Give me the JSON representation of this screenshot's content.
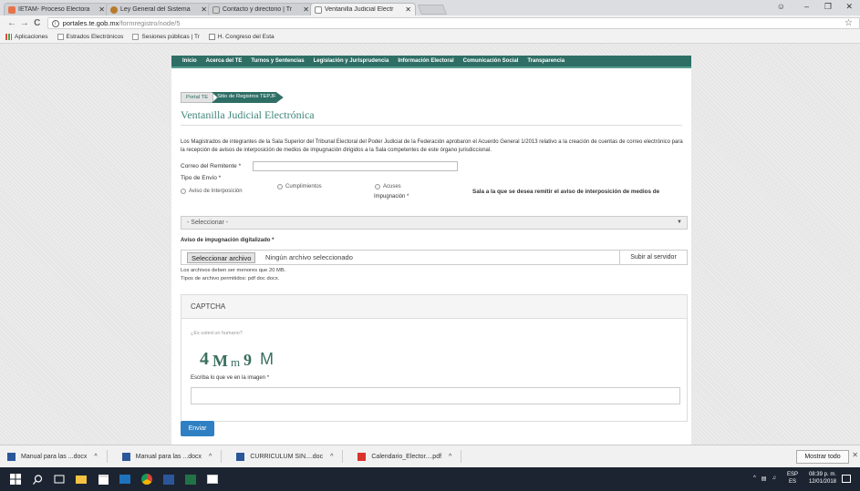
{
  "browser": {
    "tabs": [
      {
        "title": "IETAM- Proceso Electora",
        "color": "#e8734a"
      },
      {
        "title": "Ley General del Sistema",
        "color": "#b97a2a"
      },
      {
        "title": "Contacto y directorio | Tr",
        "color": "#7a7a7a"
      },
      {
        "title": "Ventanilla Judicial Electr",
        "color": "#888888"
      }
    ],
    "address": {
      "host": "portales.te.gob.mx",
      "path": "/formregistro/node/5"
    },
    "bookmarks": [
      "Aplicaciones",
      "Estrados Electrónicos",
      "Sesiones públicas | Tr",
      "H. Congreso del Esta"
    ]
  },
  "site": {
    "nav": [
      "Inicio",
      "Acerca del TE",
      "Turnos y Sentencias",
      "Legislación y Jurisprudencia",
      "Información Electoral",
      "Comunicación Social",
      "Transparencia"
    ],
    "breadcrumb": [
      "Portal TE",
      "Sitio de Registros TEPJF"
    ],
    "title": "Ventanilla Judicial Electrónica",
    "intro": "Los Magistrados de integrantes de la Sala Superior del Tribunal Electoral del Poder Judicial de la Federación aprobaron el Acuerdo General 1/2013 relativo a la creación de cuentas de correo electrónico para la recepción de avisos de interposición de medios de impugnación dirigidos a la Sala competentes de este órgano jurisdiccional."
  },
  "form": {
    "email_label": "Correo del Remitente *",
    "tipo_label": "Tipo de Envío *",
    "radio_options": [
      "Aviso de Interposición",
      "Cumplimientos",
      "Acuses"
    ],
    "radio_extra": "Impugnación *",
    "sala_label": "Sala a la que se desea remitir el aviso de interposición de medios de",
    "select_value": "- Seleccionar -",
    "aviso_label": "Aviso de impugnación digitalizado *",
    "file_button": "Seleccionar archivo",
    "file_status": "Ningún archivo seleccionado",
    "upload_button": "Subir al servidor",
    "help1": "Los archivos deben ser menores que 20 MB.",
    "help2": "Tipos de archivo permitidos: pdf doc docx."
  },
  "captcha": {
    "heading": "CAPTCHA",
    "question": "¿Es usted un humano?",
    "code": "4M9M",
    "prompt": "Escriba lo que ve en la imagen *"
  },
  "submit": "Enviar",
  "downloads": {
    "items": [
      "Manual para las ...docx",
      "Manual para las ...docx",
      "CURRICULUM SIN....doc",
      "Calendario_Elector....pdf"
    ],
    "show_all": "Mostrar todo"
  },
  "taskbar": {
    "lang1": "ESP",
    "lang2": "ES",
    "time": "08:39 p. m.",
    "date": "12/01/2018"
  }
}
